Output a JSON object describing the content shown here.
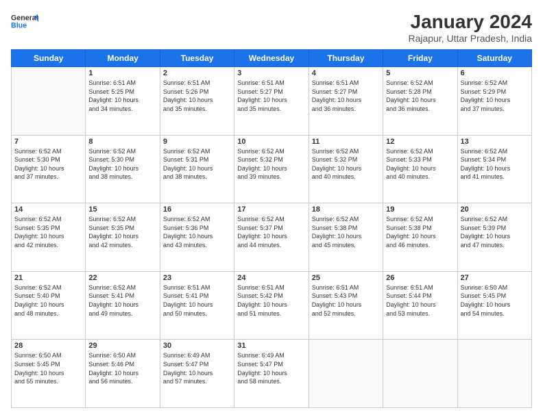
{
  "header": {
    "logo_general": "General",
    "logo_blue": "Blue",
    "month_title": "January 2024",
    "subtitle": "Rajapur, Uttar Pradesh, India"
  },
  "weekdays": [
    "Sunday",
    "Monday",
    "Tuesday",
    "Wednesday",
    "Thursday",
    "Friday",
    "Saturday"
  ],
  "weeks": [
    [
      {
        "day": "",
        "text": ""
      },
      {
        "day": "1",
        "text": "Sunrise: 6:51 AM\nSunset: 5:25 PM\nDaylight: 10 hours\nand 34 minutes."
      },
      {
        "day": "2",
        "text": "Sunrise: 6:51 AM\nSunset: 5:26 PM\nDaylight: 10 hours\nand 35 minutes."
      },
      {
        "day": "3",
        "text": "Sunrise: 6:51 AM\nSunset: 5:27 PM\nDaylight: 10 hours\nand 35 minutes."
      },
      {
        "day": "4",
        "text": "Sunrise: 6:51 AM\nSunset: 5:27 PM\nDaylight: 10 hours\nand 36 minutes."
      },
      {
        "day": "5",
        "text": "Sunrise: 6:52 AM\nSunset: 5:28 PM\nDaylight: 10 hours\nand 36 minutes."
      },
      {
        "day": "6",
        "text": "Sunrise: 6:52 AM\nSunset: 5:29 PM\nDaylight: 10 hours\nand 37 minutes."
      }
    ],
    [
      {
        "day": "7",
        "text": "Sunrise: 6:52 AM\nSunset: 5:30 PM\nDaylight: 10 hours\nand 37 minutes."
      },
      {
        "day": "8",
        "text": "Sunrise: 6:52 AM\nSunset: 5:30 PM\nDaylight: 10 hours\nand 38 minutes."
      },
      {
        "day": "9",
        "text": "Sunrise: 6:52 AM\nSunset: 5:31 PM\nDaylight: 10 hours\nand 38 minutes."
      },
      {
        "day": "10",
        "text": "Sunrise: 6:52 AM\nSunset: 5:32 PM\nDaylight: 10 hours\nand 39 minutes."
      },
      {
        "day": "11",
        "text": "Sunrise: 6:52 AM\nSunset: 5:32 PM\nDaylight: 10 hours\nand 40 minutes."
      },
      {
        "day": "12",
        "text": "Sunrise: 6:52 AM\nSunset: 5:33 PM\nDaylight: 10 hours\nand 40 minutes."
      },
      {
        "day": "13",
        "text": "Sunrise: 6:52 AM\nSunset: 5:34 PM\nDaylight: 10 hours\nand 41 minutes."
      }
    ],
    [
      {
        "day": "14",
        "text": "Sunrise: 6:52 AM\nSunset: 5:35 PM\nDaylight: 10 hours\nand 42 minutes."
      },
      {
        "day": "15",
        "text": "Sunrise: 6:52 AM\nSunset: 5:35 PM\nDaylight: 10 hours\nand 42 minutes."
      },
      {
        "day": "16",
        "text": "Sunrise: 6:52 AM\nSunset: 5:36 PM\nDaylight: 10 hours\nand 43 minutes."
      },
      {
        "day": "17",
        "text": "Sunrise: 6:52 AM\nSunset: 5:37 PM\nDaylight: 10 hours\nand 44 minutes."
      },
      {
        "day": "18",
        "text": "Sunrise: 6:52 AM\nSunset: 5:38 PM\nDaylight: 10 hours\nand 45 minutes."
      },
      {
        "day": "19",
        "text": "Sunrise: 6:52 AM\nSunset: 5:38 PM\nDaylight: 10 hours\nand 46 minutes."
      },
      {
        "day": "20",
        "text": "Sunrise: 6:52 AM\nSunset: 5:39 PM\nDaylight: 10 hours\nand 47 minutes."
      }
    ],
    [
      {
        "day": "21",
        "text": "Sunrise: 6:52 AM\nSunset: 5:40 PM\nDaylight: 10 hours\nand 48 minutes."
      },
      {
        "day": "22",
        "text": "Sunrise: 6:52 AM\nSunset: 5:41 PM\nDaylight: 10 hours\nand 49 minutes."
      },
      {
        "day": "23",
        "text": "Sunrise: 6:51 AM\nSunset: 5:41 PM\nDaylight: 10 hours\nand 50 minutes."
      },
      {
        "day": "24",
        "text": "Sunrise: 6:51 AM\nSunset: 5:42 PM\nDaylight: 10 hours\nand 51 minutes."
      },
      {
        "day": "25",
        "text": "Sunrise: 6:51 AM\nSunset: 5:43 PM\nDaylight: 10 hours\nand 52 minutes."
      },
      {
        "day": "26",
        "text": "Sunrise: 6:51 AM\nSunset: 5:44 PM\nDaylight: 10 hours\nand 53 minutes."
      },
      {
        "day": "27",
        "text": "Sunrise: 6:50 AM\nSunset: 5:45 PM\nDaylight: 10 hours\nand 54 minutes."
      }
    ],
    [
      {
        "day": "28",
        "text": "Sunrise: 6:50 AM\nSunset: 5:45 PM\nDaylight: 10 hours\nand 55 minutes."
      },
      {
        "day": "29",
        "text": "Sunrise: 6:50 AM\nSunset: 5:46 PM\nDaylight: 10 hours\nand 56 minutes."
      },
      {
        "day": "30",
        "text": "Sunrise: 6:49 AM\nSunset: 5:47 PM\nDaylight: 10 hours\nand 57 minutes."
      },
      {
        "day": "31",
        "text": "Sunrise: 6:49 AM\nSunset: 5:47 PM\nDaylight: 10 hours\nand 58 minutes."
      },
      {
        "day": "",
        "text": ""
      },
      {
        "day": "",
        "text": ""
      },
      {
        "day": "",
        "text": ""
      }
    ]
  ]
}
